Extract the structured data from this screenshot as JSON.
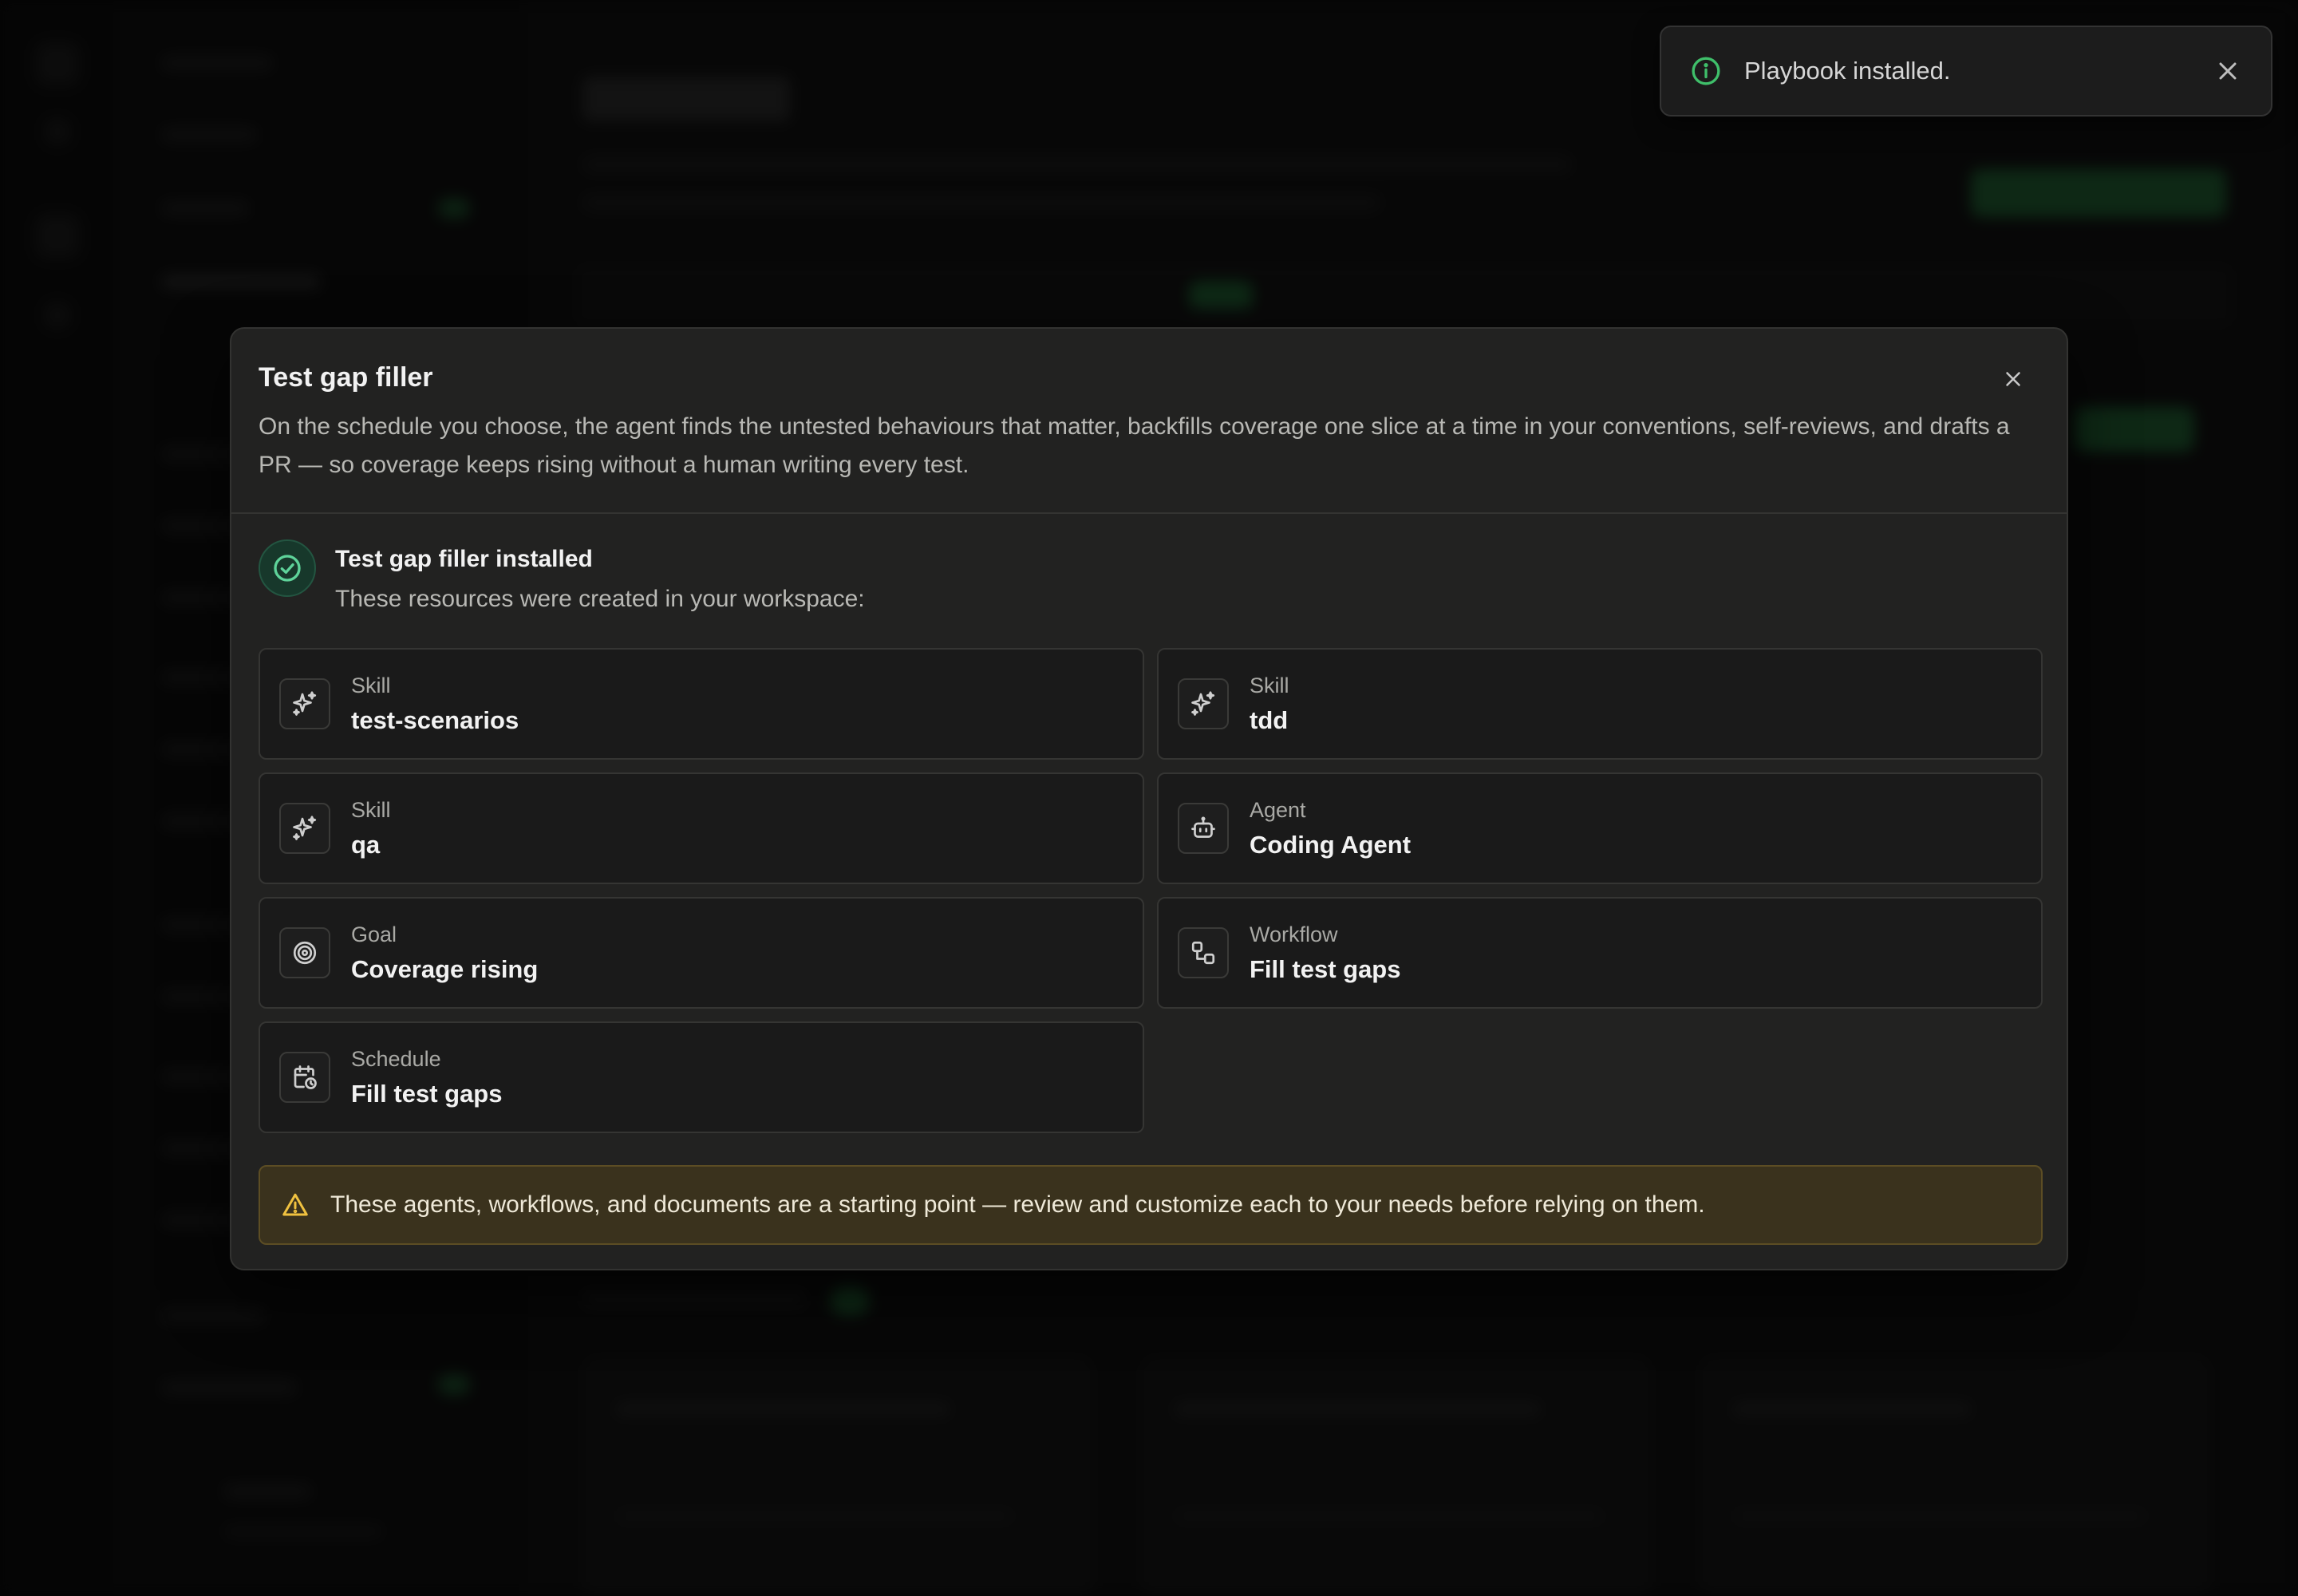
{
  "toast": {
    "message": "Playbook installed.",
    "icon": "info-circle-icon",
    "accent": "#3fbf6a"
  },
  "modal": {
    "title": "Test gap filler",
    "description": "On the schedule you choose, the agent finds the untested behaviours that matter, backfills coverage one slice at a time in your conventions, self-reviews, and drafts a PR — so coverage keeps rising without a human writing every test.",
    "success": {
      "title": "Test gap filler installed",
      "subtitle": "These resources were created in your workspace:"
    },
    "resources": [
      {
        "type": "Skill",
        "name": "test-scenarios",
        "icon": "sparkle-icon"
      },
      {
        "type": "Skill",
        "name": "tdd",
        "icon": "sparkle-icon"
      },
      {
        "type": "Skill",
        "name": "qa",
        "icon": "sparkle-icon"
      },
      {
        "type": "Agent",
        "name": "Coding Agent",
        "icon": "robot-icon"
      },
      {
        "type": "Goal",
        "name": "Coverage rising",
        "icon": "target-icon"
      },
      {
        "type": "Workflow",
        "name": "Fill test gaps",
        "icon": "workflow-icon"
      },
      {
        "type": "Schedule",
        "name": "Fill test gaps",
        "icon": "calendar-clock-icon"
      }
    ],
    "warning": "These agents, workflows, and documents are a starting point — review and customize each to your needs before relying on them."
  },
  "colors": {
    "modal_bg": "#222221",
    "success_green": "#5ed39a",
    "warning_yellow": "#f0c240",
    "warning_bg": "#3a321d"
  }
}
